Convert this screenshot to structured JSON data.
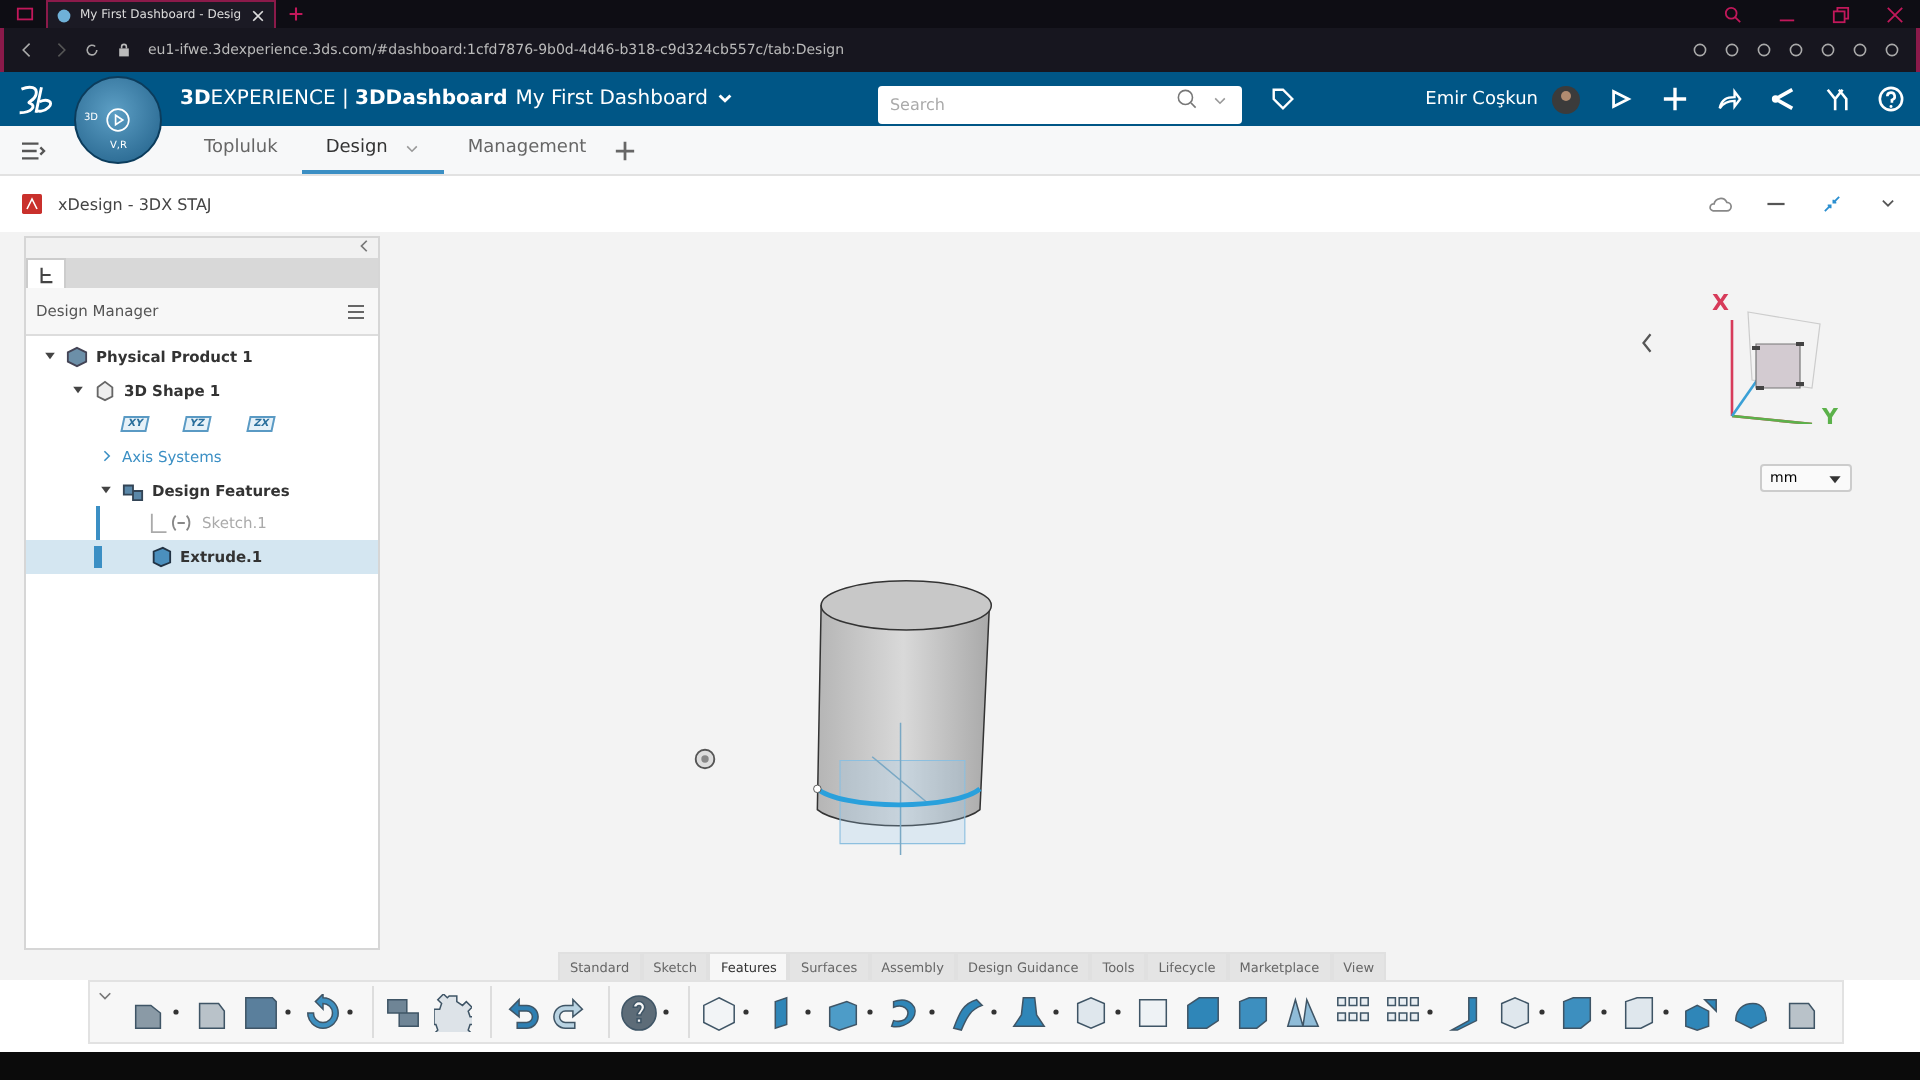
{
  "browser": {
    "tab_title": "My First Dashboard - Desig",
    "url": "eu1-ifwe.3dexperience.3ds.com/#dashboard:1cfd7876-9b0d-4d46-b318-c9d324cb557c/tab:Design"
  },
  "topbar": {
    "compass_labels": [
      "3D",
      "V,R"
    ],
    "title": "**3D**EXPERIENCE | **3DDashboard**",
    "dashboard": "My First Dashboard",
    "search": {
      "placeholder": "Search"
    },
    "user": "Emir Coşkun"
  },
  "tabs": [
    {
      "label": "Topluluk",
      "selected": false
    },
    {
      "label": "Design",
      "selected": true
    },
    {
      "label": "Management",
      "selected": false
    }
  ],
  "app": {
    "title": "xDesign - 3DX STAJ"
  },
  "panel": {
    "title": "Design Manager",
    "tree": [
      {
        "label": "Physical Product 1",
        "kind": "product",
        "expanded": true,
        "children": [
          {
            "label": "3D Shape 1",
            "kind": "shape",
            "expanded": true,
            "children": [
              {
                "kind": "planes",
                "planes": [
                  "XY",
                  "YZ",
                  "ZX"
                ]
              },
              {
                "label": "Axis Systems",
                "kind": "folder",
                "expanded": false
              },
              {
                "label": "Design Features",
                "kind": "features",
                "expanded": true,
                "children": [
                  {
                    "label": "Sketch.1",
                    "kind": "sketch",
                    "hidden": true,
                    "selected": false
                  },
                  {
                    "label": "Extrude.1",
                    "kind": "extrude",
                    "hidden": false,
                    "selected": true
                  }
                ]
              }
            ]
          }
        ]
      }
    ]
  },
  "viewer": {
    "axes": [
      "X",
      "Y"
    ],
    "unit": "mm"
  },
  "toolbar": {
    "tabs": [
      {
        "label": "Standard",
        "selected": false
      },
      {
        "label": "Sketch",
        "selected": false
      },
      {
        "label": "Features",
        "selected": true
      },
      {
        "label": "Surfaces",
        "selected": false
      },
      {
        "label": "Assembly",
        "selected": false
      },
      {
        "label": "Design Guidance",
        "selected": false
      },
      {
        "label": "Tools",
        "selected": false
      },
      {
        "label": "Lifecycle",
        "selected": false
      },
      {
        "label": "Marketplace",
        "selected": false
      },
      {
        "label": "View",
        "selected": false
      }
    ],
    "groups": [
      [
        {
          "kind": "new",
          "dropdown": true
        },
        {
          "kind": "open",
          "dropdown": false
        },
        {
          "kind": "save",
          "dropdown": true
        },
        {
          "kind": "refresh",
          "dropdown": true
        }
      ],
      [
        {
          "kind": "import",
          "dropdown": false
        },
        {
          "kind": "gear",
          "dropdown": false
        }
      ],
      [
        {
          "kind": "undo",
          "dropdown": false
        },
        {
          "kind": "redo",
          "dropdown": false
        }
      ],
      [
        {
          "kind": "help",
          "dropdown": true
        }
      ],
      [
        {
          "kind": "cube",
          "dropdown": true
        },
        {
          "kind": "pad",
          "dropdown": true
        },
        {
          "kind": "pocket",
          "dropdown": true
        },
        {
          "kind": "revolve",
          "dropdown": true
        },
        {
          "kind": "sweep",
          "dropdown": true
        },
        {
          "kind": "loft",
          "dropdown": true
        },
        {
          "kind": "shell",
          "dropdown": true
        },
        {
          "kind": "hole",
          "dropdown": false
        },
        {
          "kind": "chamfer",
          "dropdown": false
        },
        {
          "kind": "solid",
          "dropdown": false
        },
        {
          "kind": "split",
          "dropdown": false
        },
        {
          "kind": "mirror",
          "dropdown": false
        },
        {
          "kind": "pattern",
          "dropdown": true
        },
        {
          "kind": "rib",
          "dropdown": false
        },
        {
          "kind": "shell",
          "dropdown": true
        },
        {
          "kind": "solid",
          "dropdown": true
        },
        {
          "kind": "remove",
          "dropdown": true
        },
        {
          "kind": "translate",
          "dropdown": false
        },
        {
          "kind": "dome",
          "dropdown": false
        },
        {
          "kind": "open",
          "dropdown": false
        }
      ]
    ]
  }
}
